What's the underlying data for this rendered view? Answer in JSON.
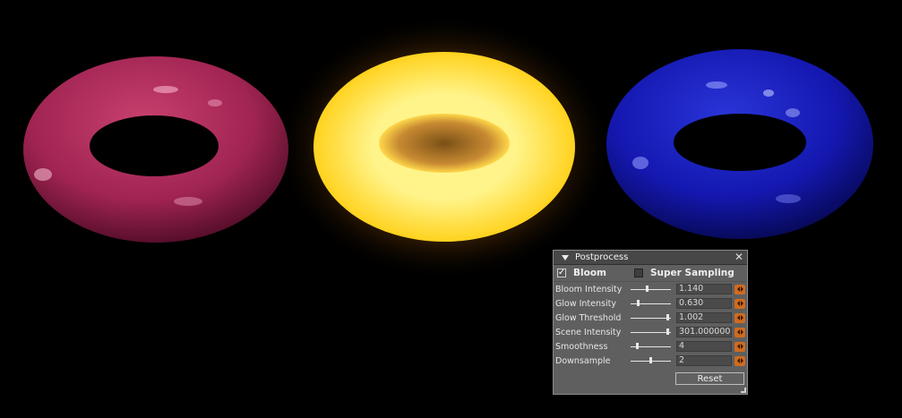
{
  "colors": {
    "background": "#000000",
    "torus_left": "#a02452",
    "torus_center": "#ffe53a",
    "torus_right": "#1418b0",
    "spinner": "#d06b1f"
  },
  "panel": {
    "title": "Postprocess",
    "collapse_icon": "triangle-down-icon",
    "close_label": "✕",
    "options": [
      {
        "label": "Bloom",
        "checked": true
      },
      {
        "label": "Super Sampling",
        "checked": false
      }
    ],
    "params": [
      {
        "label": "Bloom Intensity",
        "value": "1.140",
        "level": 0.4
      },
      {
        "label": "Glow Intensity",
        "value": "0.630",
        "level": 0.18
      },
      {
        "label": "Glow Threshold",
        "value": "1.002",
        "level": 0.92
      },
      {
        "label": "Scene Intensity",
        "value": "301.0000000",
        "level": 0.92
      },
      {
        "label": "Smoothness",
        "value": "4",
        "level": 0.15
      },
      {
        "label": "Downsample",
        "value": "2",
        "level": 0.48
      }
    ],
    "reset_label": "Reset"
  }
}
